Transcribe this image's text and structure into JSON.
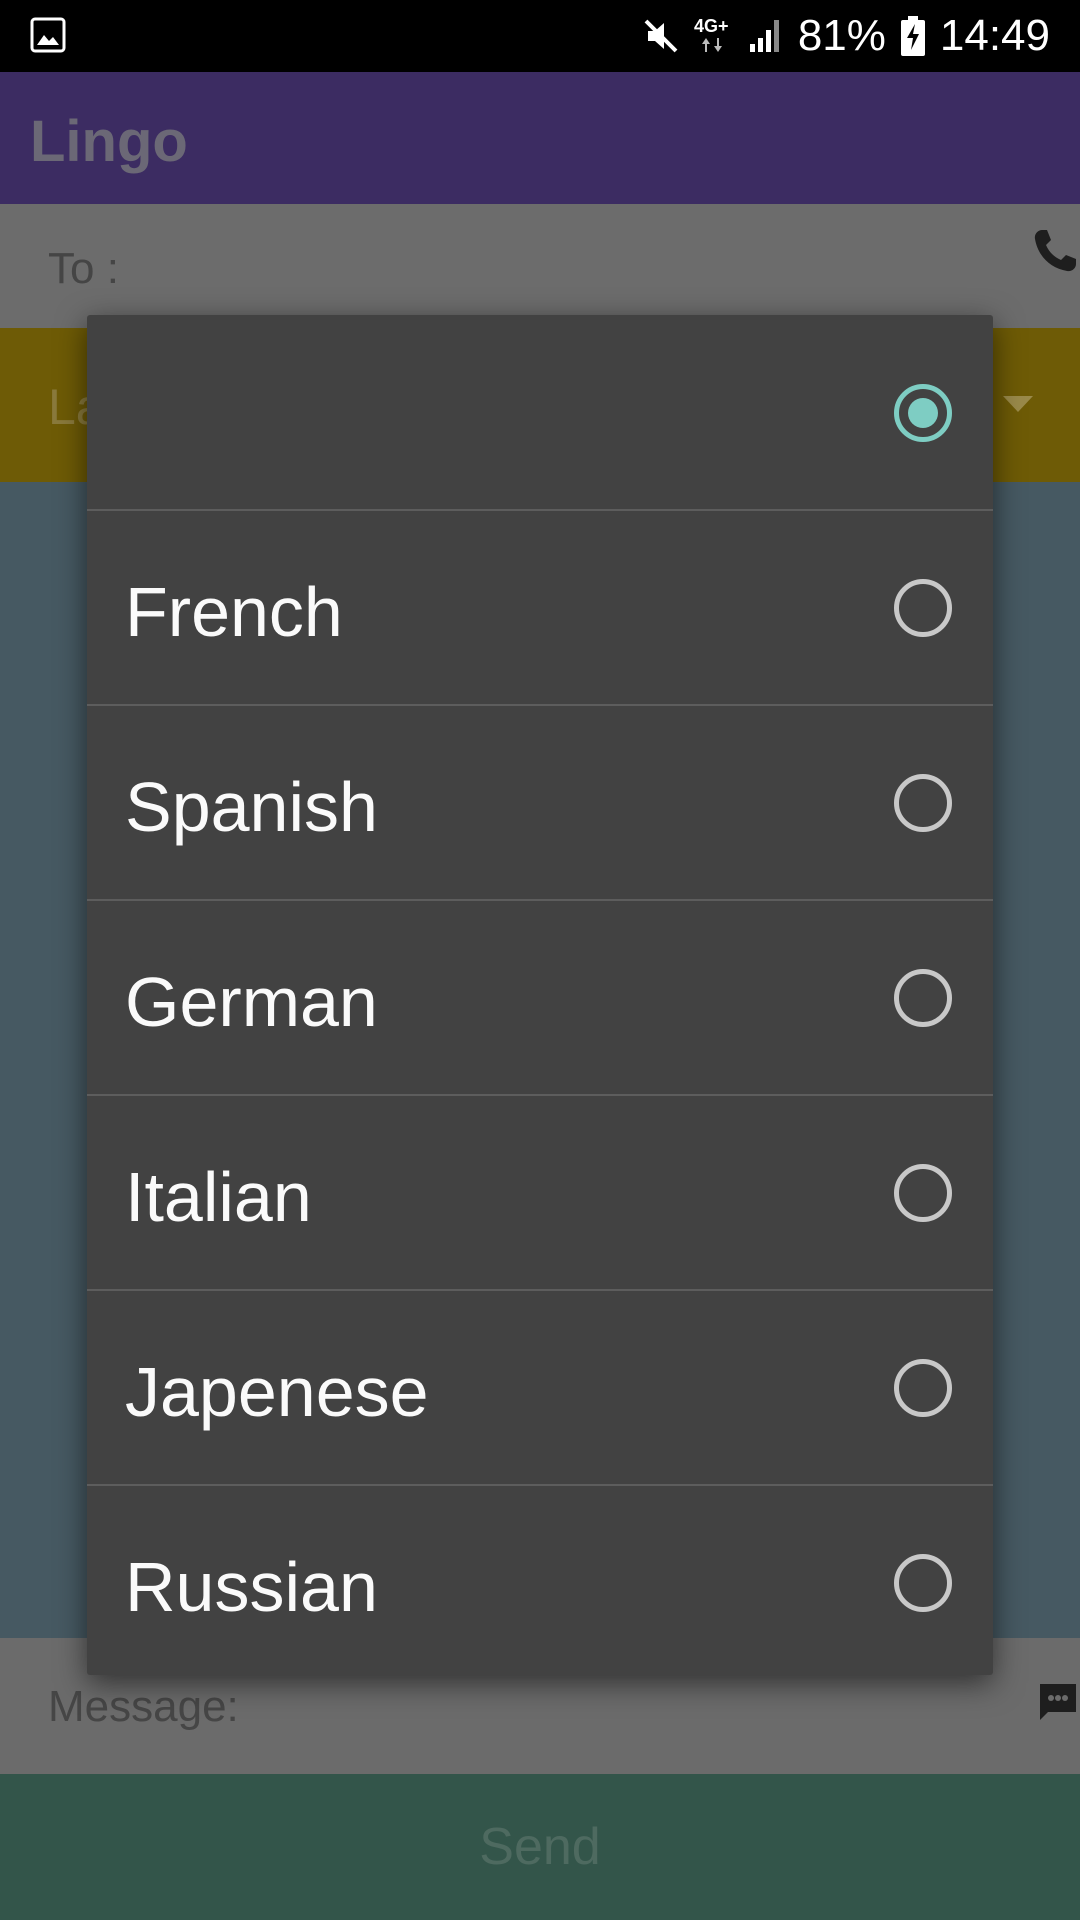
{
  "status_bar": {
    "battery": "81%",
    "time": "14:49",
    "network": "4G+",
    "icons": [
      "gallery-icon",
      "mute-icon",
      "network-arrows-icon",
      "signal-icon",
      "battery-charging-icon"
    ]
  },
  "app": {
    "title": "Lingo",
    "to_label": "To :",
    "language_label": "La",
    "message_label": "Message:",
    "send_label": "Send",
    "icons": [
      "phone-icon",
      "dropdown-caret-icon",
      "message-icon"
    ]
  },
  "dialog": {
    "options": [
      {
        "label": "",
        "selected": true
      },
      {
        "label": "French",
        "selected": false
      },
      {
        "label": "Spanish",
        "selected": false
      },
      {
        "label": "German",
        "selected": false
      },
      {
        "label": "Italian",
        "selected": false
      },
      {
        "label": "Japenese",
        "selected": false
      },
      {
        "label": "Russian",
        "selected": false
      }
    ]
  },
  "colors": {
    "app_bar": "#3c2c62",
    "radio_accent": "#7ecdc3",
    "dialog_bg": "#424242"
  }
}
